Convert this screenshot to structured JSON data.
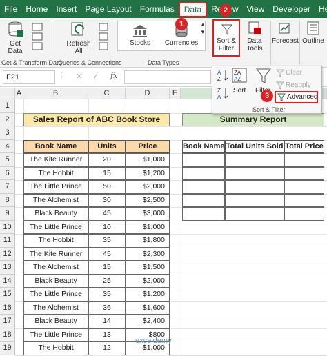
{
  "menu": [
    "File",
    "Home",
    "Insert",
    "Page Layout",
    "Formulas",
    "Data",
    "Review",
    "View",
    "Developer",
    "Help"
  ],
  "active_menu": "Data",
  "ribbon": {
    "get_data": "Get\nData",
    "refresh_all": "Refresh\nAll",
    "stocks": "Stocks",
    "currencies": "Currencies",
    "sort_filter": "Sort &\nFilter",
    "data_tools": "Data\nTools",
    "forecast": "Forecast",
    "outline": "Outline",
    "group_get_transform": "Get & Transform Data",
    "group_queries": "Queries & Connections",
    "group_data_types": "Data Types"
  },
  "formula_bar": {
    "name_box": "F21",
    "fx": "fx",
    "cancel": "✕",
    "enter": "✓"
  },
  "sort_filter_panel": {
    "sort": "Sort",
    "filter": "Filter",
    "clear": "Clear",
    "reapply": "Reapply",
    "advanced": "Advanced",
    "group_label": "Sort & Filter"
  },
  "badges": [
    "1",
    "2",
    "3"
  ],
  "columns": [
    "A",
    "B",
    "C",
    "D",
    "E",
    "F"
  ],
  "rows": [
    "1",
    "2",
    "3",
    "4",
    "5",
    "6",
    "7",
    "8",
    "9",
    "10",
    "11",
    "12",
    "13",
    "14",
    "15",
    "16",
    "17",
    "18",
    "19"
  ],
  "sales": {
    "title": "Sales Report of ABC Book Store",
    "headers": [
      "Book Name",
      "Units Sold",
      "Price"
    ],
    "rows": [
      [
        "The Kite Runner",
        "20",
        "$1,000"
      ],
      [
        "The Hobbit",
        "15",
        "$1,200"
      ],
      [
        "The Little Prince",
        "50",
        "$2,000"
      ],
      [
        "The Alchemist",
        "30",
        "$2,500"
      ],
      [
        "Black Beauty",
        "45",
        "$3,000"
      ],
      [
        "The Little Prince",
        "10",
        "$1,000"
      ],
      [
        "The Hobbit",
        "35",
        "$1,800"
      ],
      [
        "The Kite Runner",
        "45",
        "$2,300"
      ],
      [
        "The Alchemist",
        "15",
        "$1,500"
      ],
      [
        "Black Beauty",
        "25",
        "$2,000"
      ],
      [
        "The Little Prince",
        "35",
        "$1,200"
      ],
      [
        "The Alchemist",
        "36",
        "$1,600"
      ],
      [
        "Black Beauty",
        "14",
        "$2,400"
      ],
      [
        "The Little Prince",
        "13",
        "$800"
      ],
      [
        "The Hobbit",
        "12",
        "$1,000"
      ]
    ]
  },
  "summary": {
    "title": "Summary Report",
    "headers": [
      "Book Name",
      "Total Units Sold",
      "Total Price"
    ]
  },
  "watermark": "exceldemy",
  "colors": {
    "excel_green": "#217346",
    "highlight_red": "#e02020",
    "header_orange": "#fcd9a8",
    "sales_title_bg": "#fde9a6",
    "summary_title_bg": "#d6e9c6"
  }
}
